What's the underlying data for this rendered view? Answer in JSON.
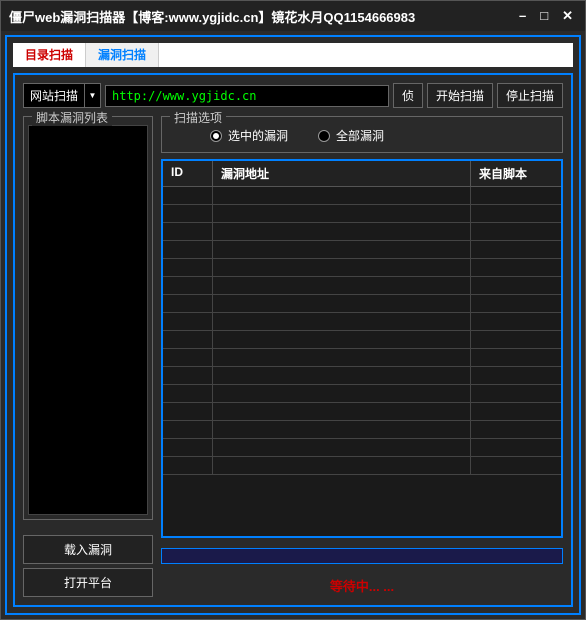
{
  "window": {
    "title": "僵尸web漏洞扫描器【博客:www.ygjidc.cn】镜花水月QQ1154666983"
  },
  "tabs": {
    "tab1": "目录扫描",
    "tab2": "漏洞扫描"
  },
  "toolbar": {
    "scan_mode": "网站扫描",
    "url": "http://www.ygjidc.cn",
    "detect": "侦",
    "start": "开始扫描",
    "stop": "停止扫描"
  },
  "left": {
    "list_title": "脚本漏洞列表",
    "load_vuln": "载入漏洞",
    "open_platform": "打开平台"
  },
  "options": {
    "title": "扫描选项",
    "selected": "选中的漏洞",
    "all": "全部漏洞"
  },
  "table": {
    "col_id": "ID",
    "col_addr": "漏洞地址",
    "col_from": "来自脚本"
  },
  "status": "等待中... ..."
}
